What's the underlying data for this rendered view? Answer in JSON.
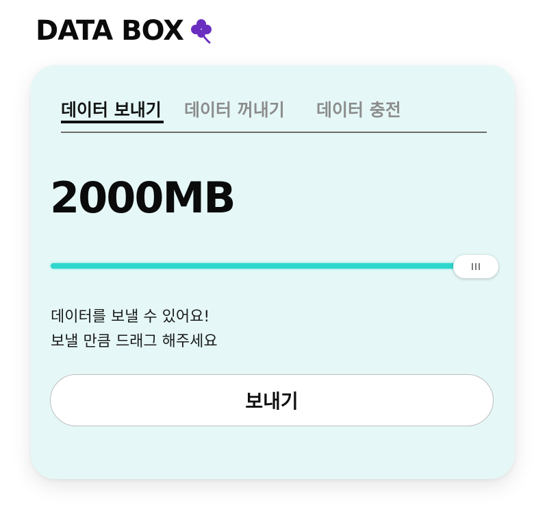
{
  "brand": {
    "title": "DATA BOX",
    "icon": "clover-icon",
    "icon_color": "#6a2fc0"
  },
  "tabs": [
    {
      "label": "데이터 보내기",
      "active": true
    },
    {
      "label": "데이터 꺼내기",
      "active": false
    },
    {
      "label": "데이터 충전",
      "active": false
    }
  ],
  "amount": "2000MB",
  "slider": {
    "fill_fraction": 1.0,
    "fill_color": "#2fd6cc",
    "thumb_icon": "grip-icon"
  },
  "description": {
    "line1": "데이터를 보낼 수 있어요!",
    "line2": "보낼 만큼 드래그 해주세요"
  },
  "send_button": {
    "label": "보내기"
  },
  "colors": {
    "card_background": "#e5f8f7",
    "accent": "#2fd6cc"
  }
}
